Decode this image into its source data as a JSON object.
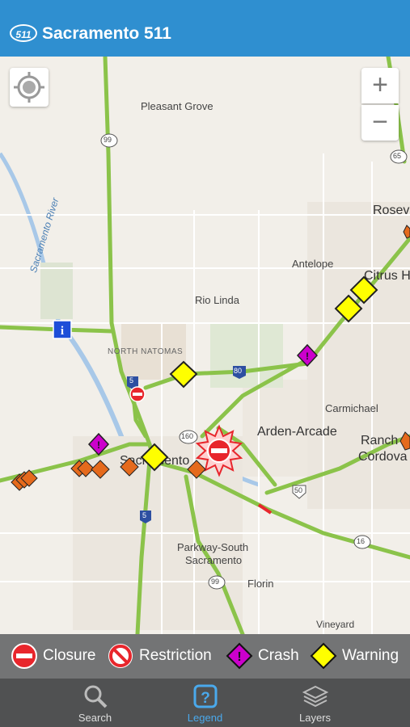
{
  "app": {
    "logo_text": "511",
    "title": "Sacramento 511"
  },
  "map": {
    "places": {
      "pleasant_grove": "Pleasant Grove",
      "roseville": "Rosev",
      "antelope": "Antelope",
      "citrus_heights": "Citrus H",
      "rio_linda": "Rio Linda",
      "north_natomas": "NORTH NATOMAS",
      "carmichael": "Carmichael",
      "arden_arcade": "Arden-Arcade",
      "rancho": "Ranch",
      "cordova": "Cordova",
      "sacramento": "Sacramento",
      "parkway_line1": "Parkway-South",
      "parkway_line2": "Sacramento",
      "florin": "Florin",
      "vineyard": "Vineyard",
      "river": "Sacramento River"
    },
    "routes": {
      "r99a": "99",
      "r99b": "99",
      "r65": "65",
      "r5a": "5",
      "r5b": "5",
      "r80": "80",
      "r160": "160",
      "r50": "50",
      "r16": "16"
    },
    "zoom_in": "+",
    "zoom_out": "−"
  },
  "legend": {
    "items": [
      {
        "label": "Closure",
        "icon": "closure-icon"
      },
      {
        "label": "Restriction",
        "icon": "restriction-icon"
      },
      {
        "label": "Crash",
        "icon": "crash-icon"
      },
      {
        "label": "Warning",
        "icon": "warning-icon"
      }
    ]
  },
  "tabs": [
    {
      "label": "Search",
      "icon": "search-icon",
      "active": false
    },
    {
      "label": "Legend",
      "icon": "legend-icon",
      "active": true
    },
    {
      "label": "Layers",
      "icon": "layers-icon",
      "active": false
    }
  ],
  "colors": {
    "header": "#2f8fd0",
    "traffic_green": "#8bc34a",
    "warning": "#ffff00",
    "crash": "#cc00cc",
    "closure": "#e8262c",
    "construction": "#e56a1c"
  }
}
